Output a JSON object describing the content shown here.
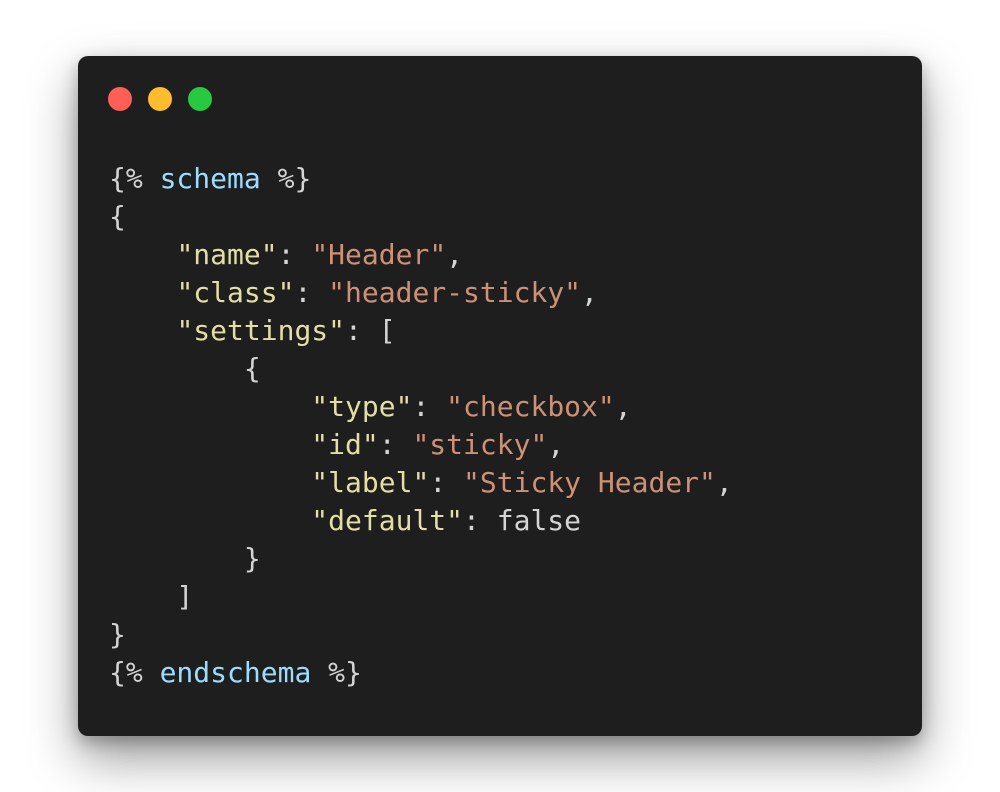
{
  "theme": {
    "page_background": "#ffffff",
    "window_background": "#1e1e1e",
    "traffic_lights": {
      "close": "#ff5f57",
      "minimize": "#febc2e",
      "maximize": "#28c840"
    },
    "token_colors": {
      "punct": "#d4d4d4",
      "tag": "#9cdcfe",
      "key": "#e2dfa6",
      "string": "#ce9178",
      "plain": "#d4d4d4"
    }
  },
  "code_lines": [
    {
      "name": "line-schema-open",
      "tokens": [
        {
          "type": "punct",
          "text": "{%"
        },
        {
          "type": "punct",
          "text": " "
        },
        {
          "type": "tag",
          "text": "schema"
        },
        {
          "type": "punct",
          "text": " %}"
        }
      ]
    },
    {
      "name": "line-open-brace",
      "tokens": [
        {
          "type": "punct",
          "text": "{"
        }
      ]
    },
    {
      "name": "line-name",
      "tokens": [
        {
          "type": "punct",
          "text": "    "
        },
        {
          "type": "key",
          "text": "\"name\""
        },
        {
          "type": "punct",
          "text": ": "
        },
        {
          "type": "str",
          "text": "\"Header\""
        },
        {
          "type": "punct",
          "text": ","
        }
      ]
    },
    {
      "name": "line-class",
      "tokens": [
        {
          "type": "punct",
          "text": "    "
        },
        {
          "type": "key",
          "text": "\"class\""
        },
        {
          "type": "punct",
          "text": ": "
        },
        {
          "type": "str",
          "text": "\"header-sticky\""
        },
        {
          "type": "punct",
          "text": ","
        }
      ]
    },
    {
      "name": "line-settings",
      "tokens": [
        {
          "type": "punct",
          "text": "    "
        },
        {
          "type": "key",
          "text": "\"settings\""
        },
        {
          "type": "punct",
          "text": ": ["
        }
      ]
    },
    {
      "name": "line-setting-open",
      "tokens": [
        {
          "type": "punct",
          "text": "        {"
        }
      ]
    },
    {
      "name": "line-type",
      "tokens": [
        {
          "type": "punct",
          "text": "            "
        },
        {
          "type": "key",
          "text": "\"type\""
        },
        {
          "type": "punct",
          "text": ": "
        },
        {
          "type": "str",
          "text": "\"checkbox\""
        },
        {
          "type": "punct",
          "text": ","
        }
      ]
    },
    {
      "name": "line-id",
      "tokens": [
        {
          "type": "punct",
          "text": "            "
        },
        {
          "type": "key",
          "text": "\"id\""
        },
        {
          "type": "punct",
          "text": ": "
        },
        {
          "type": "str",
          "text": "\"sticky\""
        },
        {
          "type": "punct",
          "text": ","
        }
      ]
    },
    {
      "name": "line-label",
      "tokens": [
        {
          "type": "punct",
          "text": "            "
        },
        {
          "type": "key",
          "text": "\"label\""
        },
        {
          "type": "punct",
          "text": ": "
        },
        {
          "type": "str",
          "text": "\"Sticky Header\""
        },
        {
          "type": "punct",
          "text": ","
        }
      ]
    },
    {
      "name": "line-default",
      "tokens": [
        {
          "type": "punct",
          "text": "            "
        },
        {
          "type": "key",
          "text": "\"default\""
        },
        {
          "type": "punct",
          "text": ": "
        },
        {
          "type": "plain",
          "text": "false"
        }
      ]
    },
    {
      "name": "line-setting-close",
      "tokens": [
        {
          "type": "punct",
          "text": "        }"
        }
      ]
    },
    {
      "name": "line-settings-close",
      "tokens": [
        {
          "type": "punct",
          "text": "    ]"
        }
      ]
    },
    {
      "name": "line-close-brace",
      "tokens": [
        {
          "type": "punct",
          "text": "}"
        }
      ]
    },
    {
      "name": "line-endschema",
      "tokens": [
        {
          "type": "punct",
          "text": "{%"
        },
        {
          "type": "punct",
          "text": " "
        },
        {
          "type": "tag",
          "text": "endschema"
        },
        {
          "type": "punct",
          "text": " %}"
        }
      ]
    }
  ]
}
